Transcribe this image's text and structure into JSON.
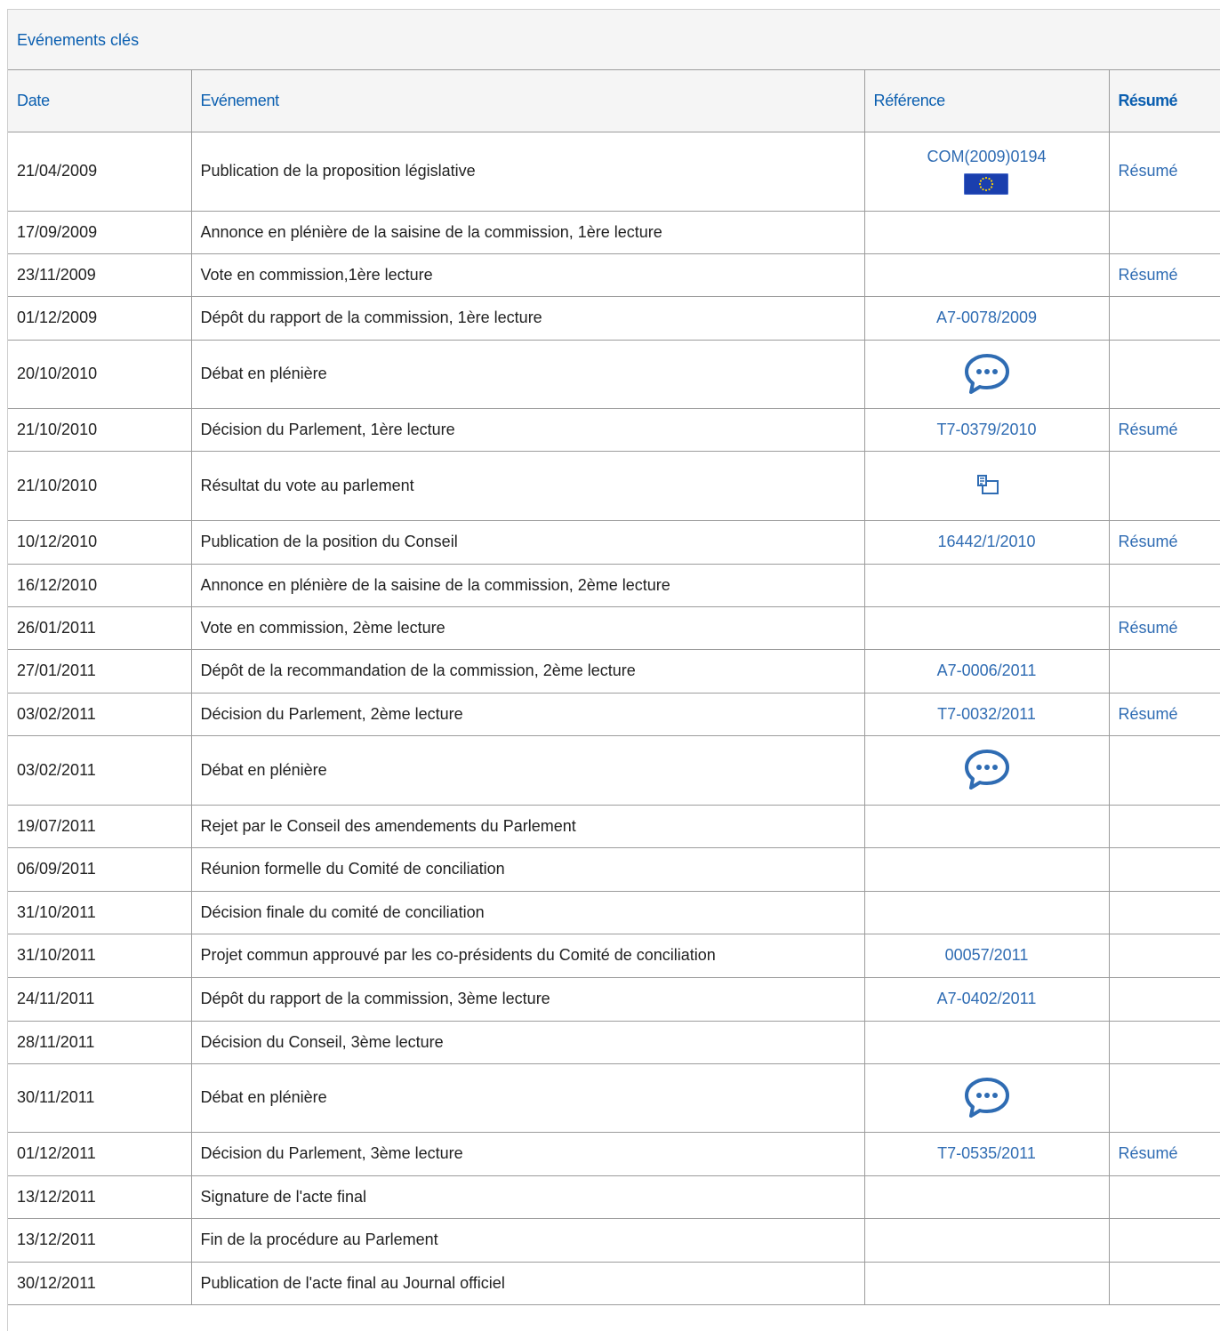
{
  "panel": {
    "title": "Evénements clés"
  },
  "table": {
    "headers": {
      "date": "Date",
      "event": "Evénement",
      "reference": "Référence",
      "summary": "Résumé"
    },
    "rows": [
      {
        "date": "21/04/2009",
        "event": "Publication de la proposition législative",
        "ref": "COM(2009)0194",
        "icon": "eu-flag-icon",
        "summary": "Résumé"
      },
      {
        "date": "17/09/2009",
        "event": "Annonce en plénière de la saisine de la commission, 1ère lecture",
        "ref": "",
        "icon": "",
        "summary": ""
      },
      {
        "date": "23/11/2009",
        "event": "Vote en commission,1ère lecture",
        "ref": "",
        "icon": "",
        "summary": "Résumé"
      },
      {
        "date": "01/12/2009",
        "event": "Dépôt du rapport de la commission, 1ère lecture",
        "ref": "A7-0078/2009",
        "icon": "",
        "summary": ""
      },
      {
        "date": "20/10/2010",
        "event": "Débat en plénière",
        "ref": "",
        "icon": "chat-bubble-icon",
        "summary": ""
      },
      {
        "date": "21/10/2010",
        "event": "Décision du Parlement, 1ère lecture",
        "ref": "T7-0379/2010",
        "icon": "",
        "summary": "Résumé"
      },
      {
        "date": "21/10/2010",
        "event": "Résultat du vote au parlement",
        "ref": "",
        "icon": "vote-result-icon",
        "summary": ""
      },
      {
        "date": "10/12/2010",
        "event": "Publication de la position du Conseil",
        "ref": "16442/1/2010",
        "icon": "",
        "summary": "Résumé"
      },
      {
        "date": "16/12/2010",
        "event": "Annonce en plénière de la saisine de la commission, 2ème lecture",
        "ref": "",
        "icon": "",
        "summary": ""
      },
      {
        "date": "26/01/2011",
        "event": "Vote en commission, 2ème lecture",
        "ref": "",
        "icon": "",
        "summary": "Résumé"
      },
      {
        "date": "27/01/2011",
        "event": "Dépôt de la recommandation de la commission, 2ème lecture",
        "ref": "A7-0006/2011",
        "icon": "",
        "summary": ""
      },
      {
        "date": "03/02/2011",
        "event": "Décision du Parlement, 2ème lecture",
        "ref": "T7-0032/2011",
        "icon": "",
        "summary": "Résumé"
      },
      {
        "date": "03/02/2011",
        "event": "Débat en plénière",
        "ref": "",
        "icon": "chat-bubble-icon",
        "summary": ""
      },
      {
        "date": "19/07/2011",
        "event": "Rejet par le Conseil des amendements du Parlement",
        "ref": "",
        "icon": "",
        "summary": ""
      },
      {
        "date": "06/09/2011",
        "event": "Réunion formelle du Comité de conciliation",
        "ref": "",
        "icon": "",
        "summary": ""
      },
      {
        "date": "31/10/2011",
        "event": "Décision finale du comité de conciliation",
        "ref": "",
        "icon": "",
        "summary": ""
      },
      {
        "date": "31/10/2011",
        "event": "Projet commun approuvé par les co-présidents du Comité de conciliation",
        "ref": "00057/2011",
        "icon": "",
        "summary": ""
      },
      {
        "date": "24/11/2011",
        "event": "Dépôt du rapport de la commission, 3ème lecture",
        "ref": "A7-0402/2011",
        "icon": "",
        "summary": ""
      },
      {
        "date": "28/11/2011",
        "event": "Décision du Conseil, 3ème lecture",
        "ref": "",
        "icon": "",
        "summary": ""
      },
      {
        "date": "30/11/2011",
        "event": "Débat en plénière",
        "ref": "",
        "icon": "chat-bubble-icon",
        "summary": ""
      },
      {
        "date": "01/12/2011",
        "event": "Décision du Parlement, 3ème lecture",
        "ref": "T7-0535/2011",
        "icon": "",
        "summary": "Résumé"
      },
      {
        "date": "13/12/2011",
        "event": "Signature de l'acte final",
        "ref": "",
        "icon": "",
        "summary": ""
      },
      {
        "date": "13/12/2011",
        "event": "Fin de la procédure au Parlement",
        "ref": "",
        "icon": "",
        "summary": ""
      },
      {
        "date": "30/12/2011",
        "event": "Publication de l'acte final au Journal officiel",
        "ref": "",
        "icon": "",
        "summary": ""
      }
    ]
  },
  "colors": {
    "link": "#2f6cb3",
    "heading": "#0b5fb0",
    "text": "#222222",
    "border": "#9c9c9c",
    "header_bg": "#f5f5f5"
  }
}
